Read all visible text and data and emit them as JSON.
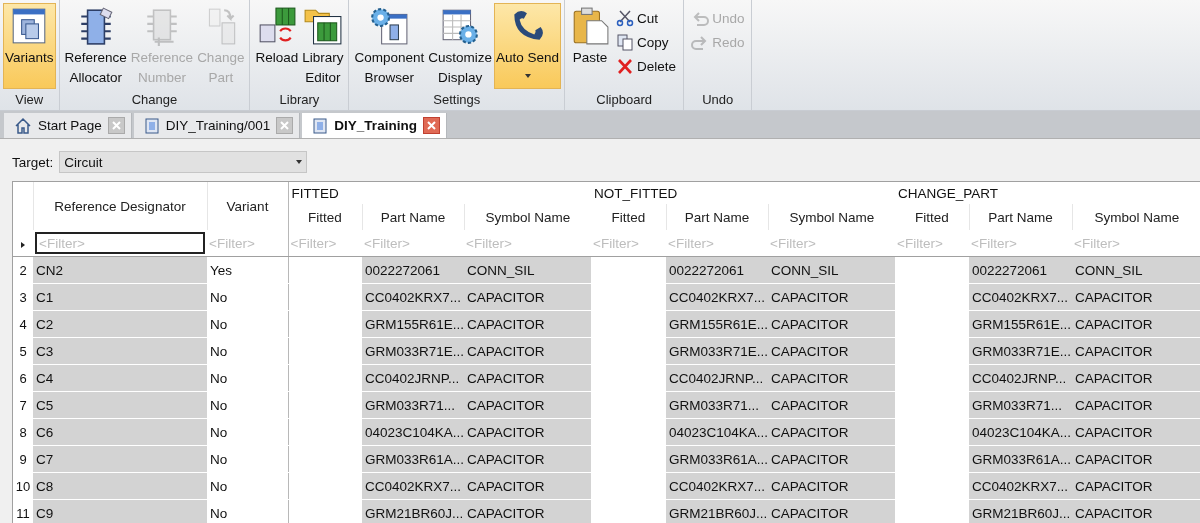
{
  "ribbon": {
    "groups": [
      {
        "label": "View",
        "buttons": [
          {
            "label": "Variants",
            "disabled": false,
            "selected": true,
            "kind": "large",
            "dropdown": false
          }
        ]
      },
      {
        "label": "Change",
        "buttons": [
          {
            "label": "Reference\nAllocator",
            "disabled": false,
            "selected": false,
            "kind": "large",
            "dropdown": false
          },
          {
            "label": "Reference\nNumber",
            "disabled": true,
            "selected": false,
            "kind": "large",
            "dropdown": false
          },
          {
            "label": "Change\nPart",
            "disabled": true,
            "selected": false,
            "kind": "large",
            "dropdown": false
          }
        ]
      },
      {
        "label": "Library",
        "buttons": [
          {
            "label": "Reload",
            "disabled": false,
            "selected": false,
            "kind": "large",
            "dropdown": false
          },
          {
            "label": "Library\nEditor",
            "disabled": false,
            "selected": false,
            "kind": "large",
            "dropdown": false
          }
        ]
      },
      {
        "label": "Settings",
        "buttons": [
          {
            "label": "Component\nBrowser",
            "disabled": false,
            "selected": false,
            "kind": "large",
            "dropdown": false
          },
          {
            "label": "Customize\nDisplay",
            "disabled": false,
            "selected": false,
            "kind": "large",
            "dropdown": false
          },
          {
            "label": "Auto Send",
            "disabled": false,
            "selected": true,
            "kind": "large",
            "dropdown": true
          }
        ]
      },
      {
        "label": "Clipboard",
        "buttons": [
          {
            "label": "Paste",
            "disabled": false,
            "selected": false,
            "kind": "large",
            "dropdown": false
          },
          {
            "label": "Cut",
            "disabled": false,
            "selected": false,
            "kind": "small"
          },
          {
            "label": "Copy",
            "disabled": false,
            "selected": false,
            "kind": "small"
          },
          {
            "label": "Delete",
            "disabled": false,
            "selected": false,
            "kind": "small"
          }
        ]
      },
      {
        "label": "Undo",
        "buttons": [
          {
            "label": "Undo",
            "disabled": true,
            "selected": false,
            "kind": "small"
          },
          {
            "label": "Redo",
            "disabled": true,
            "selected": false,
            "kind": "small"
          }
        ]
      }
    ]
  },
  "tabs": [
    {
      "label": "Start Page",
      "selected": false
    },
    {
      "label": "DIY_Training/001",
      "selected": false
    },
    {
      "label": "DIY_Training",
      "selected": true
    }
  ],
  "target": {
    "label": "Target:",
    "value": "Circuit"
  },
  "table": {
    "leading_columns": [
      {
        "label": "Reference Designator",
        "placeholder": "<Filter>",
        "shaded": true,
        "focused": true
      },
      {
        "label": "Variant",
        "placeholder": "<Filter>",
        "shaded": false,
        "focused": false
      }
    ],
    "groups": [
      {
        "label": "FITTED",
        "columns": [
          {
            "label": "Fitted",
            "placeholder": "<Filter>",
            "shaded": false,
            "focused": false
          },
          {
            "label": "Part Name",
            "placeholder": "<Filter>",
            "shaded": true,
            "focused": false
          },
          {
            "label": "Symbol Name",
            "placeholder": "<Filter>",
            "shaded": true,
            "focused": false
          }
        ]
      },
      {
        "label": "NOT_FITTED",
        "columns": [
          {
            "label": "Fitted",
            "placeholder": "<Filter>",
            "shaded": false,
            "focused": false
          },
          {
            "label": "Part Name",
            "placeholder": "<Filter>",
            "shaded": true,
            "focused": false
          },
          {
            "label": "Symbol Name",
            "placeholder": "<Filter>",
            "shaded": true,
            "focused": false
          }
        ]
      },
      {
        "label": "CHANGE_PART",
        "columns": [
          {
            "label": "Fitted",
            "placeholder": "<Filter>",
            "shaded": false,
            "focused": false
          },
          {
            "label": "Part Name",
            "placeholder": "<Filter>",
            "shaded": true,
            "focused": false
          },
          {
            "label": "Symbol Name",
            "placeholder": "<Filter>",
            "shaded": true,
            "focused": false
          }
        ]
      }
    ],
    "rows": [
      {
        "number": "2",
        "cells": [
          "CN2",
          "Yes",
          "",
          "0022272061",
          "CONN_SIL",
          "",
          "0022272061",
          "CONN_SIL",
          "",
          "0022272061",
          "CONN_SIL"
        ]
      },
      {
        "number": "3",
        "cells": [
          "C1",
          "No",
          "",
          "CC0402KRX7...",
          "CAPACITOR",
          "",
          "CC0402KRX7...",
          "CAPACITOR",
          "",
          "CC0402KRX7...",
          "CAPACITOR"
        ]
      },
      {
        "number": "4",
        "cells": [
          "C2",
          "No",
          "",
          "GRM155R61E...",
          "CAPACITOR",
          "",
          "GRM155R61E...",
          "CAPACITOR",
          "",
          "GRM155R61E...",
          "CAPACITOR"
        ]
      },
      {
        "number": "5",
        "cells": [
          "C3",
          "No",
          "",
          "GRM033R71E...",
          "CAPACITOR",
          "",
          "GRM033R71E...",
          "CAPACITOR",
          "",
          "GRM033R71E...",
          "CAPACITOR"
        ]
      },
      {
        "number": "6",
        "cells": [
          "C4",
          "No",
          "",
          "CC0402JRNP...",
          "CAPACITOR",
          "",
          "CC0402JRNP...",
          "CAPACITOR",
          "",
          "CC0402JRNP...",
          "CAPACITOR"
        ]
      },
      {
        "number": "7",
        "cells": [
          "C5",
          "No",
          "",
          "GRM033R71...",
          "CAPACITOR",
          "",
          "GRM033R71...",
          "CAPACITOR",
          "",
          "GRM033R71...",
          "CAPACITOR"
        ]
      },
      {
        "number": "8",
        "cells": [
          "C6",
          "No",
          "",
          "04023C104KA...",
          "CAPACITOR",
          "",
          "04023C104KA...",
          "CAPACITOR",
          "",
          "04023C104KA...",
          "CAPACITOR"
        ]
      },
      {
        "number": "9",
        "cells": [
          "C7",
          "No",
          "",
          "GRM033R61A...",
          "CAPACITOR",
          "",
          "GRM033R61A...",
          "CAPACITOR",
          "",
          "GRM033R61A...",
          "CAPACITOR"
        ]
      },
      {
        "number": "10",
        "cells": [
          "C8",
          "No",
          "",
          "CC0402KRX7...",
          "CAPACITOR",
          "",
          "CC0402KRX7...",
          "CAPACITOR",
          "",
          "CC0402KRX7...",
          "CAPACITOR"
        ]
      },
      {
        "number": "11",
        "cells": [
          "C9",
          "No",
          "",
          "GRM21BR60J...",
          "CAPACITOR",
          "",
          "GRM21BR60J...",
          "CAPACITOR",
          "",
          "GRM21BR60J...",
          "CAPACITOR"
        ]
      }
    ]
  }
}
